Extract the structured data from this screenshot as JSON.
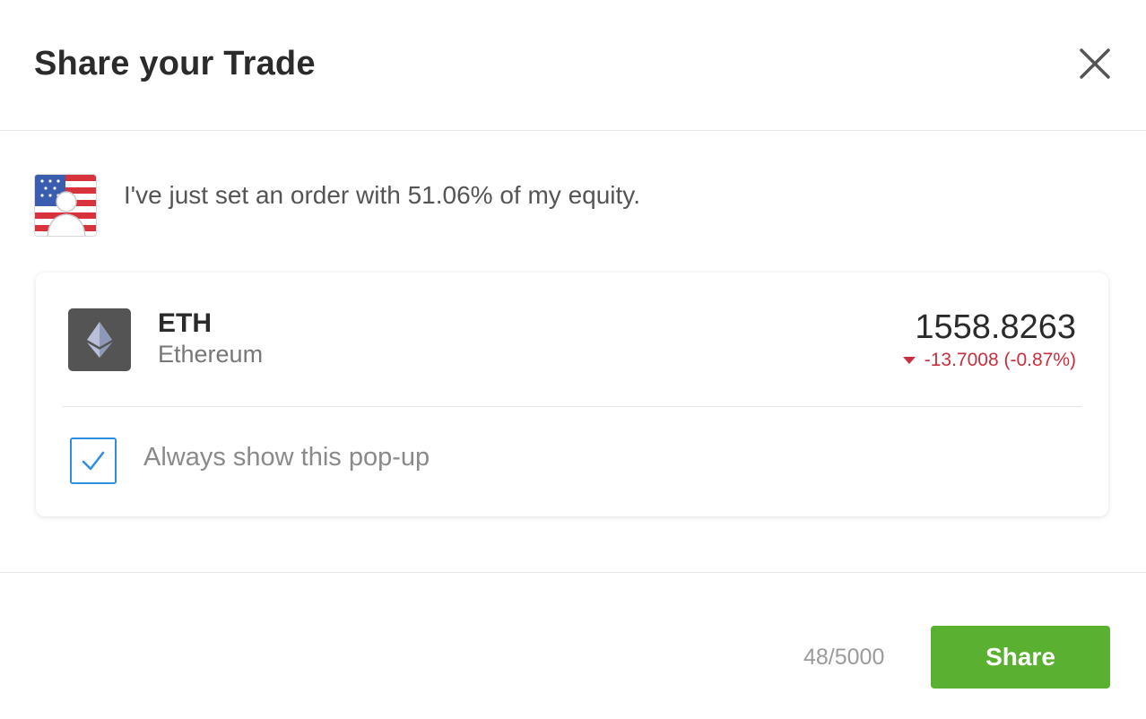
{
  "dialog": {
    "title": "Share your Trade",
    "close_icon": "close-icon"
  },
  "message": {
    "text": "I've just set an order with 51.06% of my equity.",
    "avatar_icon": "user-avatar-us-flag"
  },
  "instrument": {
    "icon": "ethereum-icon",
    "symbol": "ETH",
    "name": "Ethereum",
    "price": "1558.8263",
    "change": "-13.7008 (-0.87%)",
    "change_direction": "down",
    "change_color": "#c8303f"
  },
  "options": {
    "always_show_label": "Always show this pop-up",
    "always_show_checked": true
  },
  "footer": {
    "char_count": "48/5000",
    "share_label": "Share",
    "share_color": "#5ab031"
  }
}
